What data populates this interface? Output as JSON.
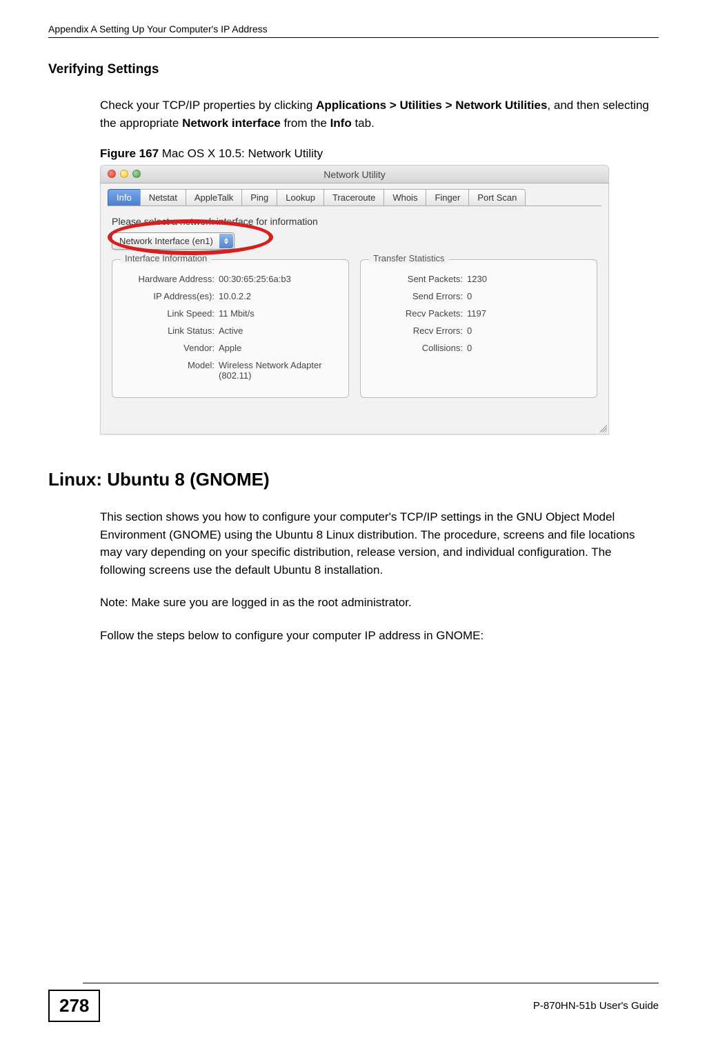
{
  "header": {
    "left": "Appendix A Setting Up Your Computer's IP Address",
    "right": ""
  },
  "section1": {
    "title": "Verifying Settings",
    "p1_a": "Check your TCP/IP properties by clicking ",
    "p1_b": "Applications > Utilities > Network Utilities",
    "p1_c": ", and then selecting the appropriate ",
    "p1_d": "Network interface",
    "p1_e": " from the ",
    "p1_f": "Info",
    "p1_g": " tab.",
    "figlabel_a": "Figure 167",
    "figlabel_b": "   Mac OS X 10.5: Network Utility"
  },
  "macwin": {
    "title": "Network Utility",
    "tabs": [
      "Info",
      "Netstat",
      "AppleTalk",
      "Ping",
      "Lookup",
      "Traceroute",
      "Whois",
      "Finger",
      "Port Scan"
    ],
    "prompt": "Please select a network interface for information",
    "dropdown": "Network Interface (en1)",
    "panel1_title": "Interface Information",
    "panel2_title": "Transfer Statistics",
    "info": {
      "hw_label": "Hardware Address:",
      "hw_val": "00:30:65:25:6a:b3",
      "ip_label": "IP Address(es):",
      "ip_val": "10.0.2.2",
      "speed_label": "Link Speed:",
      "speed_val": "11 Mbit/s",
      "status_label": "Link Status:",
      "status_val": "Active",
      "vendor_label": "Vendor:",
      "vendor_val": "Apple",
      "model_label": "Model:",
      "model_val": "Wireless Network Adapter (802.11)"
    },
    "stats": {
      "sent_label": "Sent Packets:",
      "sent_val": "1230",
      "serr_label": "Send Errors:",
      "serr_val": "0",
      "recv_label": "Recv Packets:",
      "recv_val": "1197",
      "rerr_label": "Recv Errors:",
      "rerr_val": "0",
      "coll_label": "Collisions:",
      "coll_val": "0"
    }
  },
  "section2": {
    "title": "Linux: Ubuntu 8 (GNOME)",
    "p1": "This section shows you how to configure your computer's TCP/IP settings in the GNU Object Model Environment (GNOME) using the Ubuntu 8 Linux distribution. The procedure, screens and file locations may vary depending on your specific distribution, release version, and individual configuration. The following screens use the default Ubuntu 8 installation.",
    "note": "Note: Make sure you are logged in as the root administrator.",
    "p2": "Follow the steps below to configure your computer IP address in GNOME:"
  },
  "footer": {
    "page": "278",
    "guide": "P-870HN-51b User's Guide"
  }
}
